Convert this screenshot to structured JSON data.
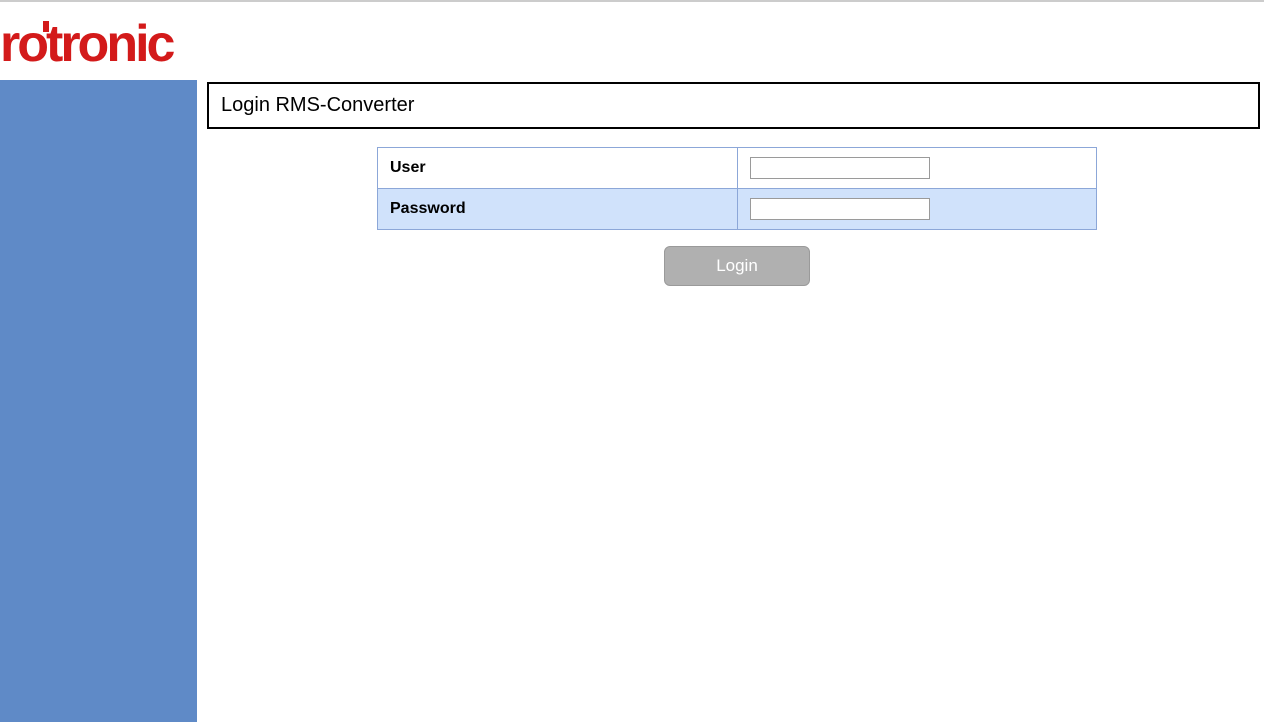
{
  "brand": {
    "name": "rotronic",
    "color": "#d31a1a"
  },
  "page": {
    "title": "Login RMS-Converter"
  },
  "form": {
    "user_label": "User",
    "password_label": "Password",
    "user_value": "",
    "password_value": "",
    "login_button": "Login"
  },
  "colors": {
    "sidebar": "#5f8ac7",
    "row_alt": "#d0e2fb",
    "border": "#8ca7d8",
    "button_bg": "#b0b0b0"
  }
}
